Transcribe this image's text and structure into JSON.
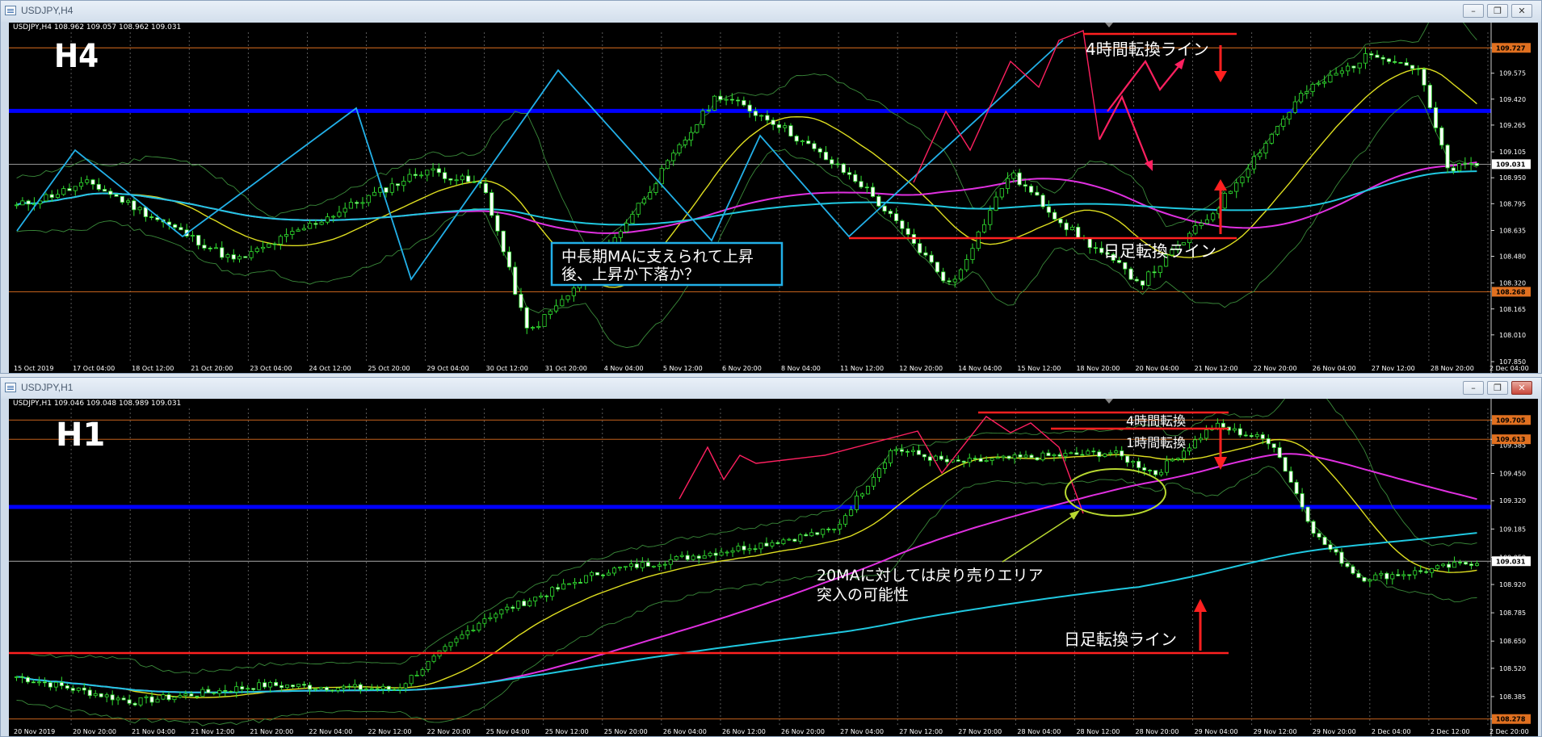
{
  "windows": {
    "top": {
      "title": "USDJPY,H4",
      "minimize": "–",
      "restore": "❐",
      "close": "✕"
    },
    "bottom": {
      "title": "USDJPY,H1",
      "minimize": "–",
      "restore": "❐",
      "close": "✕"
    }
  },
  "chart_data": [
    {
      "type": "candlestick",
      "symbol_line": "USDJPY,H4  108.962 109.057 108.962 109.031",
      "timeframe_label": "H4",
      "ylim": [
        107.85,
        109.82
      ],
      "y_ticks": [
        "109.727",
        "109.575",
        "109.420",
        "109.265",
        "109.105",
        "108.950",
        "108.795",
        "108.635",
        "108.480",
        "108.320",
        "108.165",
        "108.010",
        "107.850"
      ],
      "x_ticks": [
        "15 Oct 2019",
        "17 Oct 04:00",
        "18 Oct 12:00",
        "21 Oct 20:00",
        "23 Oct 04:00",
        "24 Oct 12:00",
        "25 Oct 20:00",
        "29 Oct 04:00",
        "30 Oct 12:00",
        "31 Oct 20:00",
        "4 Nov 04:00",
        "5 Nov 12:00",
        "6 Nov 20:00",
        "8 Nov 04:00",
        "11 Nov 12:00",
        "12 Nov 20:00",
        "14 Nov 04:00",
        "15 Nov 12:00",
        "18 Nov 20:00",
        "20 Nov 04:00",
        "21 Nov 12:00",
        "22 Nov 20:00",
        "26 Nov 04:00",
        "27 Nov 12:00",
        "28 Nov 20:00",
        "2 Dec 04:00"
      ],
      "price_labels": [
        {
          "value": 109.727,
          "label": "109.727",
          "bg": "#e07020"
        },
        {
          "value": 109.031,
          "label": "109.031",
          "bg": "#ffffff"
        },
        {
          "value": 108.268,
          "label": "108.268",
          "bg": "#e07020"
        }
      ],
      "horizontal_lines": [
        {
          "value": 109.727,
          "color": "#e07020",
          "style": "thin"
        },
        {
          "value": 109.35,
          "color": "#0000ff",
          "style": "thick"
        },
        {
          "value": 109.031,
          "color": "#aaaaaa",
          "style": "thin"
        },
        {
          "value": 108.268,
          "color": "#e07020",
          "style": "thin"
        }
      ],
      "annotations": [
        "4時間転換ライン",
        "日足転換ライン",
        "中長期MAに支えられて上昇",
        "後、上昇か下落か？"
      ],
      "ma_colors": {
        "ma20": "#dede20",
        "ma_mid": "#e030e0",
        "ma_long": "#20c8e0"
      }
    },
    {
      "type": "candlestick",
      "symbol_line": "USDJPY,H1  109.046 109.048 108.989 109.031",
      "timeframe_label": "H1",
      "ylim": [
        108.25,
        109.76
      ],
      "y_ticks": [
        "109.705",
        "109.613",
        "109.585",
        "109.450",
        "109.320",
        "109.185",
        "109.050",
        "108.920",
        "108.785",
        "108.650",
        "108.520",
        "108.385",
        "108.278"
      ],
      "x_ticks": [
        "20 Nov 2019",
        "20 Nov 20:00",
        "21 Nov 04:00",
        "21 Nov 12:00",
        "21 Nov 20:00",
        "22 Nov 04:00",
        "22 Nov 12:00",
        "22 Nov 20:00",
        "25 Nov 04:00",
        "25 Nov 12:00",
        "25 Nov 20:00",
        "26 Nov 04:00",
        "26 Nov 12:00",
        "26 Nov 20:00",
        "27 Nov 04:00",
        "27 Nov 12:00",
        "27 Nov 20:00",
        "28 Nov 04:00",
        "28 Nov 12:00",
        "28 Nov 20:00",
        "29 Nov 04:00",
        "29 Nov 12:00",
        "29 Nov 20:00",
        "2 Dec 04:00",
        "2 Dec 12:00",
        "2 Dec 20:00"
      ],
      "price_labels": [
        {
          "value": 109.705,
          "label": "109.705",
          "bg": "#e07020"
        },
        {
          "value": 109.613,
          "label": "109.613",
          "bg": "#e07020"
        },
        {
          "value": 109.031,
          "label": "109.031",
          "bg": "#ffffff"
        },
        {
          "value": 108.278,
          "label": "108.278",
          "bg": "#e07020"
        }
      ],
      "horizontal_lines": [
        {
          "value": 109.705,
          "color": "#e07020",
          "style": "thin"
        },
        {
          "value": 109.613,
          "color": "#e07020",
          "style": "thin"
        },
        {
          "value": 109.29,
          "color": "#0000ff",
          "style": "thick"
        },
        {
          "value": 109.031,
          "color": "#aaaaaa",
          "style": "thin"
        },
        {
          "value": 108.278,
          "color": "#e07020",
          "style": "thin"
        }
      ],
      "annotations": [
        "4時間転換",
        "1時間転換",
        "20MAに対しては戻り売りエリア",
        "突入の可能性",
        "日足転換ライン"
      ]
    }
  ]
}
